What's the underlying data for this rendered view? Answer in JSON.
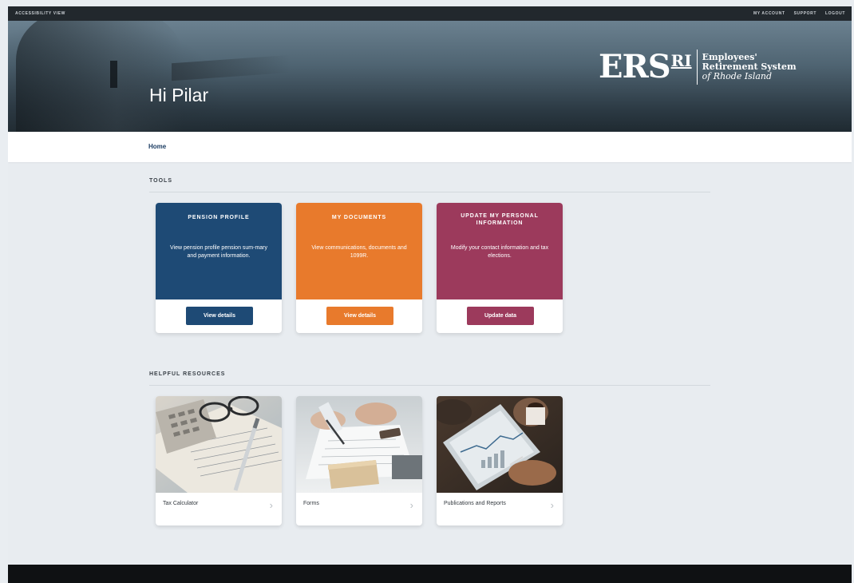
{
  "util": {
    "accessibility": "ACCESSIBILITY VIEW",
    "links": [
      "MY ACCOUNT",
      "SUPPORT",
      "LOGOUT"
    ]
  },
  "hero": {
    "greeting": "Hi Pilar"
  },
  "logo": {
    "mark": "ERS",
    "ri": "RI",
    "line1": "Employees'",
    "line2": "Retirement System",
    "line3": "of Rhode Island"
  },
  "nav": {
    "home": "Home"
  },
  "tools": {
    "title": "TOOLS",
    "cards": [
      {
        "title": "PENSION PROFILE",
        "desc": "View pension profile pension sum-mary and payment information.",
        "button": "View details",
        "color": "#1e4a75"
      },
      {
        "title": "MY DOCUMENTS",
        "desc": "View communications, documents and 1099R.",
        "button": "View details",
        "color": "#e87a2c"
      },
      {
        "title": "UPDATE MY PERSONAL INFORMATION",
        "desc": "Modify your contact information and tax elections.",
        "button": "Update data",
        "color": "#9c3a5c"
      }
    ]
  },
  "resources": {
    "title": "HELPFUL RESOURCES",
    "cards": [
      {
        "label": "Tax Calculator",
        "icon": "chevron-right-icon"
      },
      {
        "label": "Forms",
        "icon": "chevron-right-icon"
      },
      {
        "label": "Publications and Reports",
        "icon": "chevron-right-icon"
      }
    ]
  },
  "colors": {
    "navy": "#1e4a75",
    "orange": "#e87a2c",
    "plum": "#9c3a5c",
    "background": "#e8ecf0"
  }
}
